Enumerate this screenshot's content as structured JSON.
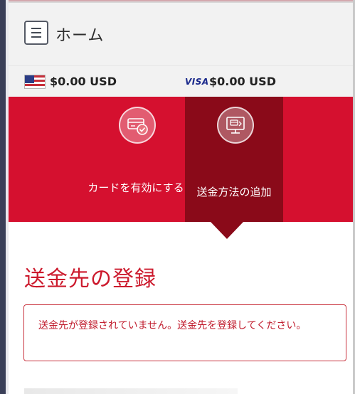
{
  "header": {
    "title": "ホーム",
    "menu_icon": "hamburger-menu-icon"
  },
  "balances": {
    "usd_flag_icon": "us-flag-icon",
    "usd_amount": "$0.00 USD",
    "visa_logo_text": "VISA",
    "visa_amount": "$0.00 USD"
  },
  "actions": [
    {
      "label": "カードを有効にする",
      "icon": "card-check-icon",
      "selected": false
    },
    {
      "label": "送金方法の追加",
      "icon": "monitor-card-icon",
      "selected": true
    }
  ],
  "section": {
    "title": "送金先の登録",
    "alert_message": "送金先が登録されていません。送金先を登録してください。"
  },
  "colors": {
    "brand_red": "#d5102f",
    "selected_red": "#8a0a19",
    "alert_text": "#c01b2c"
  }
}
